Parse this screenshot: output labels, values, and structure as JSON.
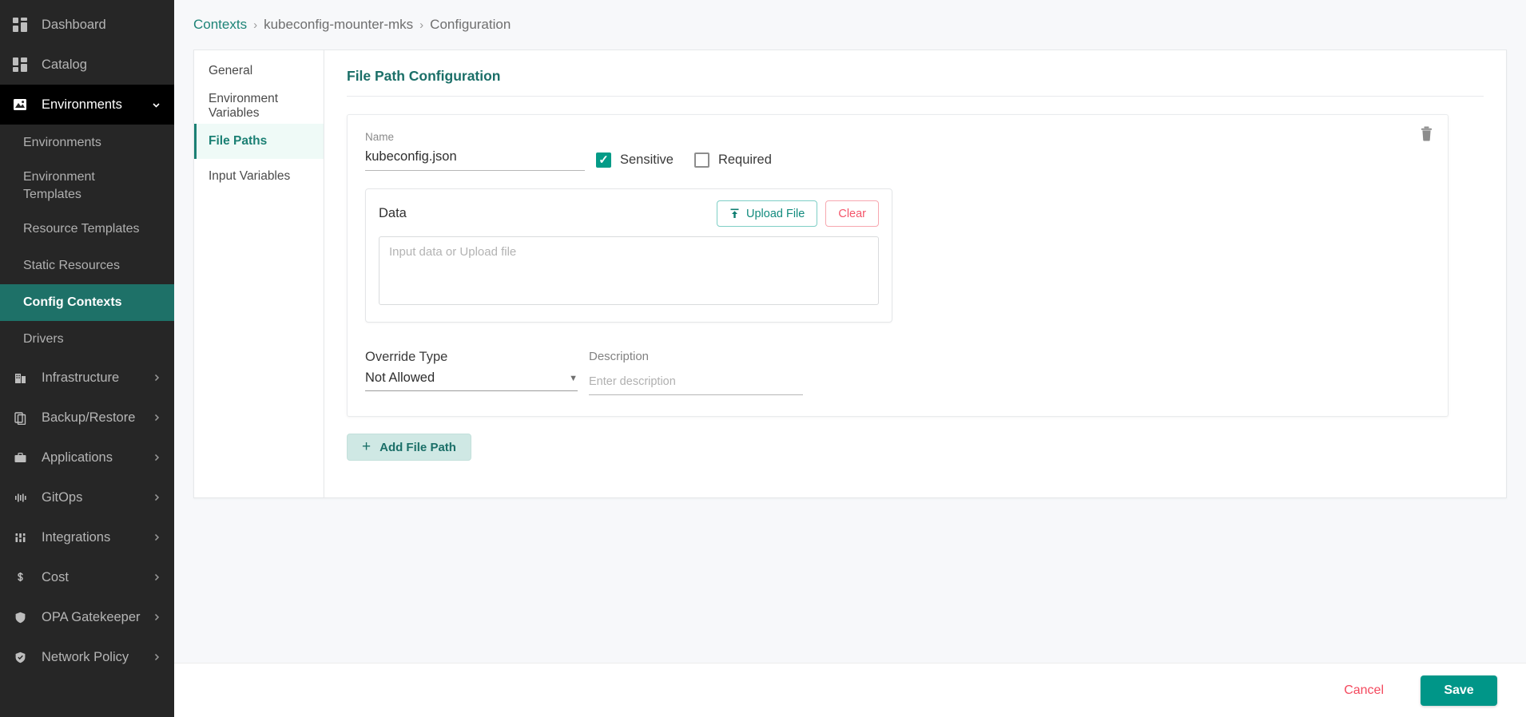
{
  "sidebar": {
    "items": [
      {
        "label": "Dashboard",
        "icon": "dashboard-icon",
        "state": "normal"
      },
      {
        "label": "Catalog",
        "icon": "catalog-icon",
        "state": "normal"
      },
      {
        "label": "Environments",
        "icon": "environments-icon",
        "state": "active-group",
        "chevron": "chevron-down-icon"
      }
    ],
    "sub_items": [
      {
        "label": "Environments",
        "active": false
      },
      {
        "label": "Environment Templates",
        "active": false
      },
      {
        "label": "Resource Templates",
        "active": false
      },
      {
        "label": "Static Resources",
        "active": false
      },
      {
        "label": "Config Contexts",
        "active": true
      },
      {
        "label": "Drivers",
        "active": false
      }
    ],
    "bottom_items": [
      {
        "label": "Infrastructure",
        "icon": "building-icon",
        "chevron": "chevron-right-icon"
      },
      {
        "label": "Backup/Restore",
        "icon": "copy-icon",
        "chevron": "chevron-right-icon"
      },
      {
        "label": "Applications",
        "icon": "briefcase-icon",
        "chevron": "chevron-right-icon"
      },
      {
        "label": "GitOps",
        "icon": "gitops-icon",
        "chevron": "chevron-right-icon"
      },
      {
        "label": "Integrations",
        "icon": "integrations-icon",
        "chevron": "chevron-right-icon"
      },
      {
        "label": "Cost",
        "icon": "dollar-icon",
        "chevron": "chevron-right-icon"
      },
      {
        "label": "OPA Gatekeeper",
        "icon": "shield-icon",
        "chevron": "chevron-right-icon"
      },
      {
        "label": "Network Policy",
        "icon": "shield-check-icon",
        "chevron": "chevron-right-icon"
      }
    ]
  },
  "breadcrumb": {
    "root": "Contexts",
    "middle": "kubeconfig-mounter-mks",
    "current": "Configuration",
    "separator": "›"
  },
  "tabs": [
    {
      "label": "General",
      "active": false
    },
    {
      "label": "Environment Variables",
      "active": false
    },
    {
      "label": "File Paths",
      "active": true
    },
    {
      "label": "Input Variables",
      "active": false
    }
  ],
  "panel": {
    "title": "File Path Configuration",
    "name_label": "Name",
    "name_value": "kubeconfig.json",
    "sensitive_label": "Sensitive",
    "sensitive_checked": true,
    "required_label": "Required",
    "required_checked": false,
    "data_label": "Data",
    "upload_label": "Upload File",
    "clear_label": "Clear",
    "data_placeholder": "Input data or Upload file",
    "data_value": "",
    "override_label": "Override Type",
    "override_value": "Not Allowed",
    "description_label": "Description",
    "description_placeholder": "Enter description",
    "description_value": "",
    "add_file_path_label": "Add File Path",
    "add_plus": "+",
    "delete_icon": "trash-icon"
  },
  "footer": {
    "cancel_label": "Cancel",
    "save_label": "Save"
  },
  "colors": {
    "accent_teal": "#009688",
    "sidebar_bg": "#262626",
    "active_sub": "#1e7168",
    "danger_red": "#f4495e",
    "page_bg": "#f7f8fa"
  }
}
